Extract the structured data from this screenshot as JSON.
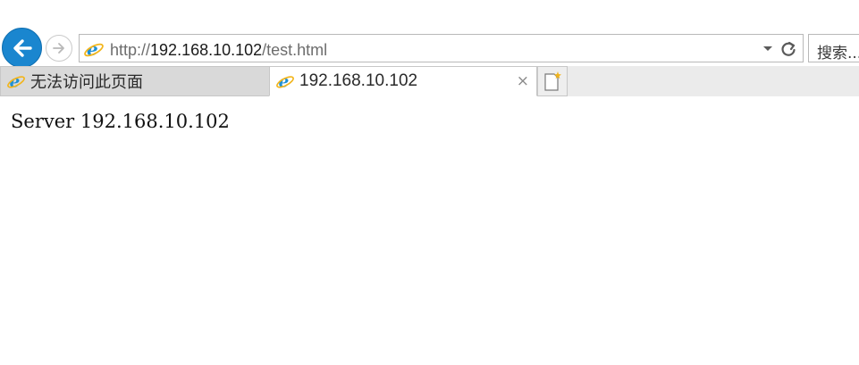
{
  "navigation": {
    "back_icon": "back-arrow-icon",
    "forward_icon": "forward-arrow-icon"
  },
  "address_bar": {
    "url_prefix": "http://",
    "url_host": "192.168.10.102",
    "url_path": "/test.html",
    "site_icon": "ie-icon",
    "dropdown_icon": "chevron-down-icon",
    "refresh_icon": "refresh-icon"
  },
  "search_box": {
    "placeholder": "搜索..."
  },
  "tabs": [
    {
      "label": "无法访问此页面",
      "active": false,
      "icon": "ie-icon"
    },
    {
      "label": "192.168.10.102",
      "active": true,
      "icon": "ie-icon",
      "close_label": "×"
    }
  ],
  "new_tab_icon": "new-tab-icon",
  "page": {
    "text": "Server 192.168.10.102"
  },
  "colors": {
    "accent": "#1a86cf",
    "inactive_tab": "#d9d9d9",
    "ie_blue": "#1e90d6",
    "ie_gold": "#f2b51c"
  }
}
